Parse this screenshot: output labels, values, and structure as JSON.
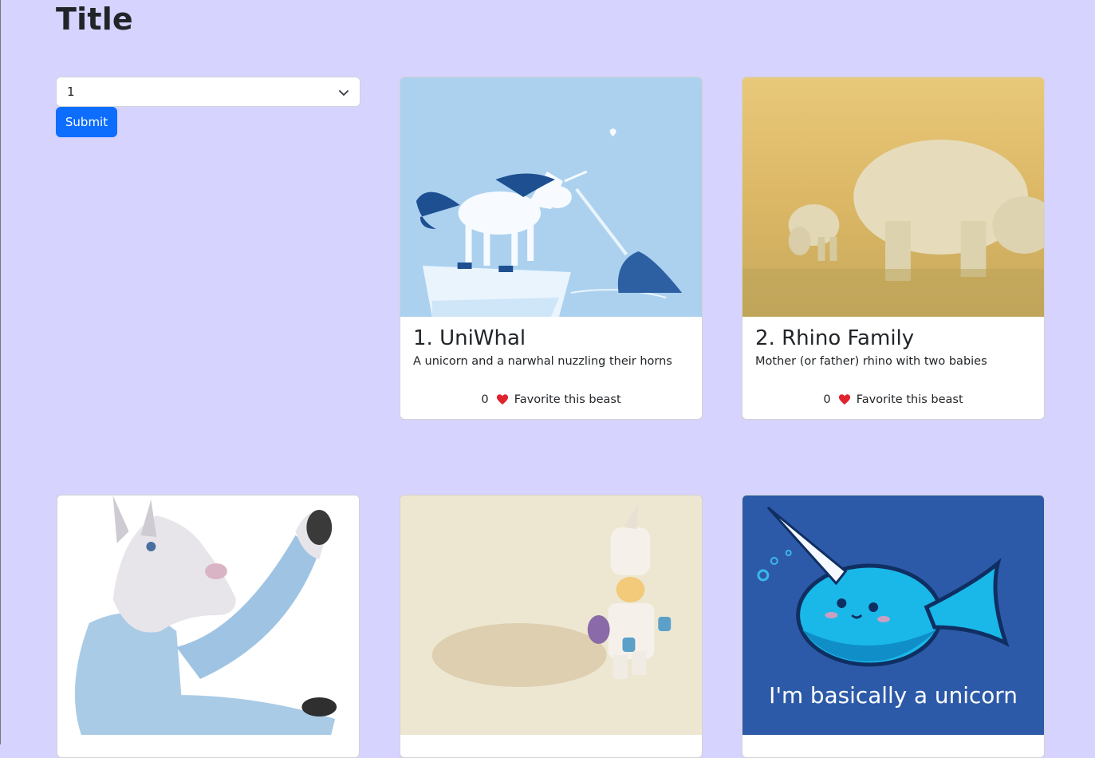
{
  "page": {
    "title": "Title"
  },
  "filter": {
    "selected_value": "1",
    "submit_label": "Submit"
  },
  "cards": [
    {
      "title": "1. UniWhal",
      "description": "A unicorn and a narwhal nuzzling their horns",
      "favorite_count": "0",
      "favorite_label": "Favorite this beast",
      "image": "unicorn-narwhal-illustration"
    },
    {
      "title": "2. Rhino Family",
      "description": "Mother (or father) rhino with two babies",
      "favorite_count": "0",
      "favorite_label": "Favorite this beast",
      "image": "rhino-photo"
    },
    {
      "image": "unicorn-mask-person-photo"
    },
    {
      "image": "lego-unicorn-figure-photo"
    },
    {
      "image": "narwhal-cartoon",
      "image_caption": "I'm basically a unicorn"
    }
  ],
  "colors": {
    "background": "#d6d3fe",
    "primary": "#0d6efd",
    "heart": "#e0242f"
  }
}
